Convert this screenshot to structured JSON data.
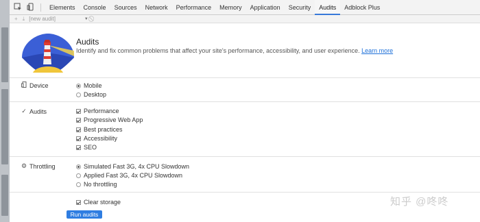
{
  "devtools": {
    "tabs": [
      "Elements",
      "Console",
      "Sources",
      "Network",
      "Performance",
      "Memory",
      "Application",
      "Security",
      "Audits",
      "Adblock Plus"
    ],
    "active_tab": "Audits",
    "subbar": {
      "add": "+",
      "select_value": "[new audit]"
    }
  },
  "audits": {
    "title": "Audits",
    "subtitle": "Identify and fix common problems that affect your site's performance, accessibility, and user experience.",
    "learn_more": "Learn more",
    "device": {
      "label": "Device",
      "options": [
        {
          "label": "Mobile",
          "selected": true
        },
        {
          "label": "Desktop",
          "selected": false
        }
      ]
    },
    "categories": {
      "label": "Audits",
      "options": [
        {
          "label": "Performance",
          "checked": true
        },
        {
          "label": "Progressive Web App",
          "checked": true
        },
        {
          "label": "Best practices",
          "checked": true
        },
        {
          "label": "Accessibility",
          "checked": true
        },
        {
          "label": "SEO",
          "checked": true
        }
      ]
    },
    "throttling": {
      "label": "Throttling",
      "options": [
        {
          "label": "Simulated Fast 3G, 4x CPU Slowdown",
          "selected": true
        },
        {
          "label": "Applied Fast 3G, 4x CPU Slowdown",
          "selected": false
        },
        {
          "label": "No throttling",
          "selected": false
        }
      ]
    },
    "clear_storage": {
      "label": "Clear storage",
      "checked": true
    },
    "run_button": "Run audits"
  },
  "watermark": "知乎 @咚咚",
  "colors": {
    "accent": "#2f7de1",
    "link": "#1a6ed8",
    "tab_underline": "#3879d9"
  }
}
